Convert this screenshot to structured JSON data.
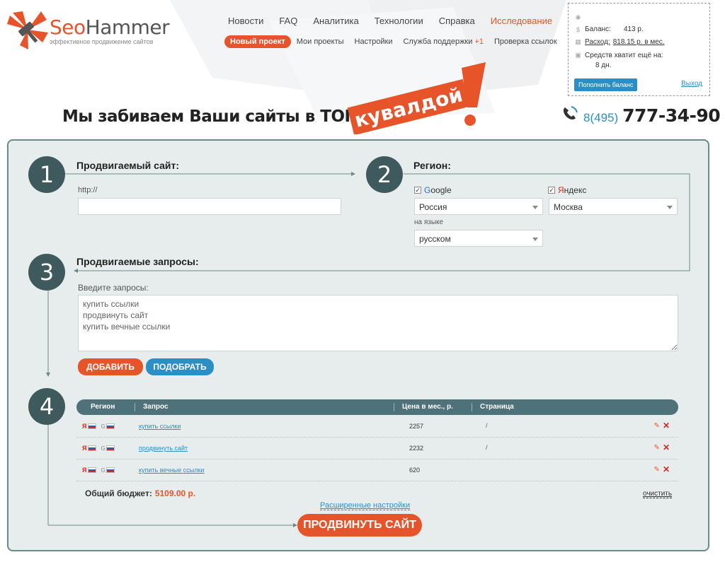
{
  "logo": {
    "name_accent": "Seo",
    "name_rest": "Hammer",
    "tagline": "эффективное продвижение сайтов"
  },
  "topnav": [
    "Новости",
    "FAQ",
    "Аналитика",
    "Технологии",
    "Справка"
  ],
  "topnav_highlight": "Исследование",
  "subnav": {
    "new_project": "Новый проект",
    "items": [
      "Мои проекты",
      "Настройки"
    ],
    "support": "Служба поддержки",
    "support_badge": "+1",
    "check": "Проверка ссылок"
  },
  "balance": {
    "balance_label": "Баланс:",
    "balance_value": "413 р.",
    "expense_label": "Расход:",
    "expense_value": "818.15 р. в мес.",
    "enough_label": "Средств хватит ещё на:",
    "enough_value": "8 дн.",
    "fund_button": "Пополнить баланс",
    "exit_link": "Выход"
  },
  "slogan": "Мы забиваем Ваши сайты в ТОП",
  "stamp": "кувалдой",
  "phone": {
    "prefix": "8(495)",
    "number": "777-34-90"
  },
  "step1": {
    "number": "1",
    "title": "Продвигаемый сайт:",
    "url_label": "http://",
    "url_value": ""
  },
  "step2": {
    "number": "2",
    "title": "Регион:",
    "google_g": "G",
    "google_rest": "oogle",
    "yandex_y": "Я",
    "yandex_rest": "ндекс",
    "google_region": "Россия",
    "yandex_region": "Москва",
    "language_label": "на языке",
    "language_value": "русском"
  },
  "step3": {
    "number": "3",
    "title": "Продвигаемые запросы:",
    "queries_label": "Введите запросы:",
    "queries_value": "купить ссылки\nпродвинуть сайт\nкупить вечные ссылки",
    "add_button": "ДОБАВИТЬ",
    "pick_button": "ПОДОБРАТЬ"
  },
  "step4": {
    "number": "4",
    "columns": [
      "Регион",
      "Запрос",
      "Цена в мес., р.",
      "Страница"
    ],
    "yandex_mark": "Я",
    "google_mark": "G",
    "rows": [
      {
        "query": "купить ссылки",
        "price": "2257",
        "page": "/"
      },
      {
        "query": "продвинуть сайт",
        "price": "2232",
        "page": "/"
      },
      {
        "query": "купить вечные ссылки",
        "price": "620",
        "page": ""
      }
    ],
    "budget_label": "Общий бюджет:",
    "budget_value": "5109.00 р.",
    "clear_link": "очистить",
    "advanced_link": "Расширенные настройки",
    "promote_button": "ПРОДВИНУТЬ САЙТ"
  }
}
